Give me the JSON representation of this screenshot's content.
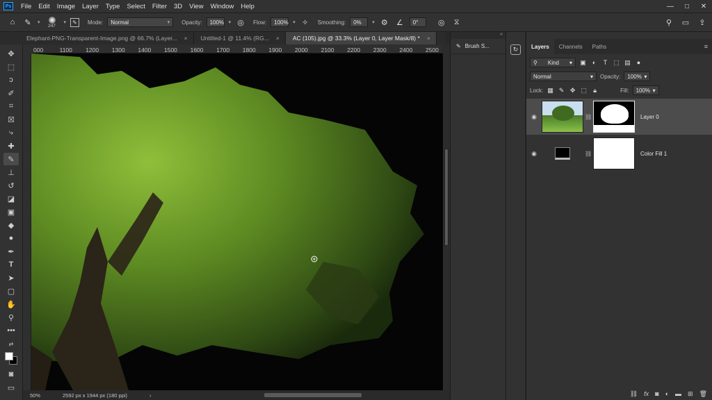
{
  "menubar": {
    "logo": "Ps",
    "items": [
      "File",
      "Edit",
      "Image",
      "Layer",
      "Type",
      "Select",
      "Filter",
      "3D",
      "View",
      "Window",
      "Help"
    ],
    "window_controls": [
      "—",
      "□",
      "✕"
    ]
  },
  "options": {
    "brush_size": "247",
    "mode_label": "Mode:",
    "mode_value": "Normal",
    "opacity_label": "Opacity:",
    "opacity_value": "100%",
    "flow_label": "Flow:",
    "flow_value": "100%",
    "smoothing_label": "Smoothing:",
    "smoothing_value": "0%",
    "angle_value": "0°"
  },
  "tabs": [
    {
      "label": "Elephant-PNG-Transparent-Image.png @ 66.7% (Layer...",
      "close": "×"
    },
    {
      "label": "Untitled-1 @ 11.4% (RG...",
      "close": "×"
    },
    {
      "label": "AC (105).jpg @ 33.3% (Layer 0, Layer Mask/8) *",
      "close": "×"
    }
  ],
  "ruler": {
    "ticks": [
      "000",
      "1100",
      "1200",
      "1300",
      "1400",
      "1500",
      "1600",
      "1700",
      "1800",
      "1900",
      "2000",
      "2100",
      "2200",
      "2300",
      "2400",
      "2500"
    ]
  },
  "status": {
    "zoom": "50%",
    "doc_info": "2592 px x 1944 px (180 ppi)",
    "arrow": "›"
  },
  "brush_panel": {
    "label": "Brush S..."
  },
  "layers_panel": {
    "tabs": [
      "Layers",
      "Channels",
      "Paths"
    ],
    "filter_label": "Kind",
    "blend_mode": "Normal",
    "opacity_label": "Opacity:",
    "opacity_value": "100%",
    "lock_label": "Lock:",
    "fill_label": "Fill:",
    "fill_value": "100%",
    "layers": [
      {
        "name": "Layer 0",
        "selected": true
      },
      {
        "name": "Color Fill 1",
        "selected": false
      }
    ]
  },
  "colors": {
    "accent": "#31a8ff",
    "foliage": "#5d8a22",
    "canvas_bg": "#050505"
  }
}
